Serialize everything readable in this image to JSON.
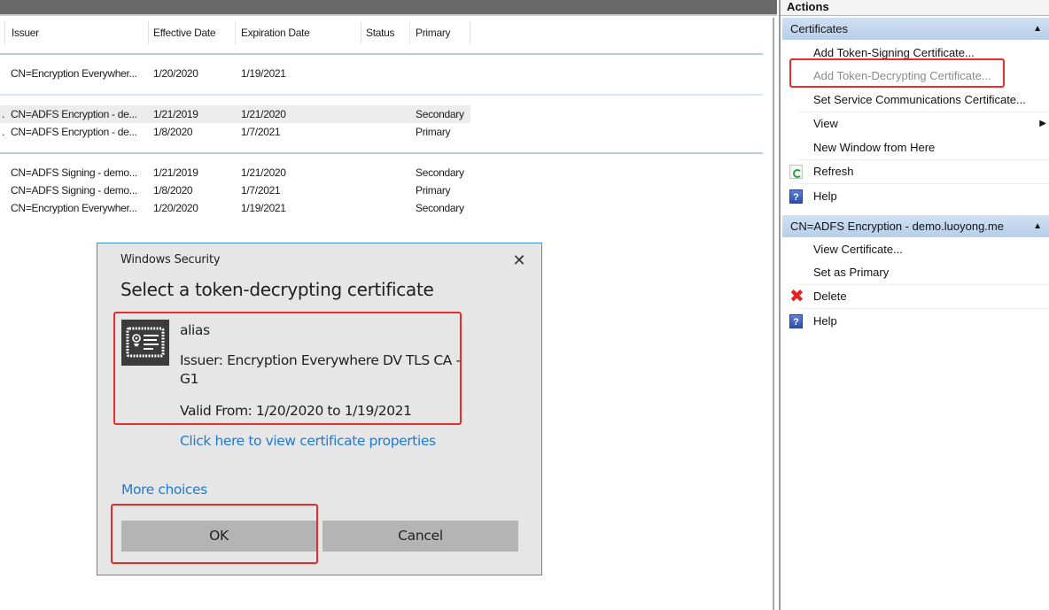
{
  "list": {
    "columns": [
      "Issuer",
      "Effective Date",
      "Expiration Date",
      "Status",
      "Primary"
    ],
    "groups": [
      {
        "rows": [
          {
            "prefix": "",
            "issuer": "CN=Encryption Everywher...",
            "effective": "1/20/2020",
            "expiration": "1/19/2021",
            "status": "",
            "primary": ""
          }
        ]
      },
      {
        "rows": [
          {
            "prefix": ".",
            "issuer": "CN=ADFS Encryption - de...",
            "effective": "1/21/2019",
            "expiration": "1/21/2020",
            "status": "",
            "primary": "Secondary",
            "selected": true
          },
          {
            "prefix": ".",
            "issuer": "CN=ADFS Encryption - de...",
            "effective": "1/8/2020",
            "expiration": "1/7/2021",
            "status": "",
            "primary": "Primary"
          }
        ]
      },
      {
        "rows": [
          {
            "prefix": "",
            "issuer": "CN=ADFS Signing - demo...",
            "effective": "1/21/2019",
            "expiration": "1/21/2020",
            "status": "",
            "primary": "Secondary"
          },
          {
            "prefix": "",
            "issuer": "CN=ADFS Signing - demo...",
            "effective": "1/8/2020",
            "expiration": "1/7/2021",
            "status": "",
            "primary": "Primary"
          },
          {
            "prefix": "",
            "issuer": "CN=Encryption Everywher...",
            "effective": "1/20/2020",
            "expiration": "1/19/2021",
            "status": "",
            "primary": "Secondary"
          }
        ]
      }
    ]
  },
  "actions": {
    "title": "Actions",
    "sections": [
      {
        "title": "Certificates",
        "items": [
          {
            "label": "Add Token-Signing Certificate...",
            "icon": "",
            "disabled": false
          },
          {
            "label": "Add Token-Decrypting Certificate...",
            "icon": "",
            "disabled": true,
            "highlighted": true
          },
          {
            "label": "Set Service Communications Certificate...",
            "icon": "",
            "disabled": false
          },
          {
            "label": "View",
            "icon": "",
            "submenu": true
          },
          {
            "label": "New Window from Here",
            "icon": ""
          },
          {
            "label": "Refresh",
            "icon": "refresh-icon"
          },
          {
            "label": "Help",
            "icon": "help-icon"
          }
        ]
      },
      {
        "title": "CN=ADFS Encryption - demo.luoyong.me",
        "items": [
          {
            "label": "View Certificate...",
            "icon": ""
          },
          {
            "label": "Set as Primary",
            "icon": ""
          },
          {
            "label": "Delete",
            "icon": "delete-icon"
          },
          {
            "label": "Help",
            "icon": "help-icon"
          }
        ]
      }
    ],
    "collapse_glyph": "▲",
    "submenu_glyph": "▶",
    "help_glyph": "?",
    "delete_glyph": "✖"
  },
  "dialog": {
    "caption": "Windows Security",
    "close_glyph": "✕",
    "heading": "Select a token-decrypting certificate",
    "certificate": {
      "alias": "alias",
      "issuer": "Issuer: Encryption Everywhere DV TLS CA - G1",
      "valid": "Valid From: 1/20/2020 to 1/19/2021"
    },
    "properties_link": "Click here to view certificate properties",
    "more_choices": "More choices",
    "ok_label": "OK",
    "cancel_label": "Cancel"
  },
  "colors": {
    "highlight_box": "#ee2a2a",
    "link": "#1f7ad6",
    "dialog_border": "#3a8ee6",
    "section_header": "#c4d8ee"
  }
}
